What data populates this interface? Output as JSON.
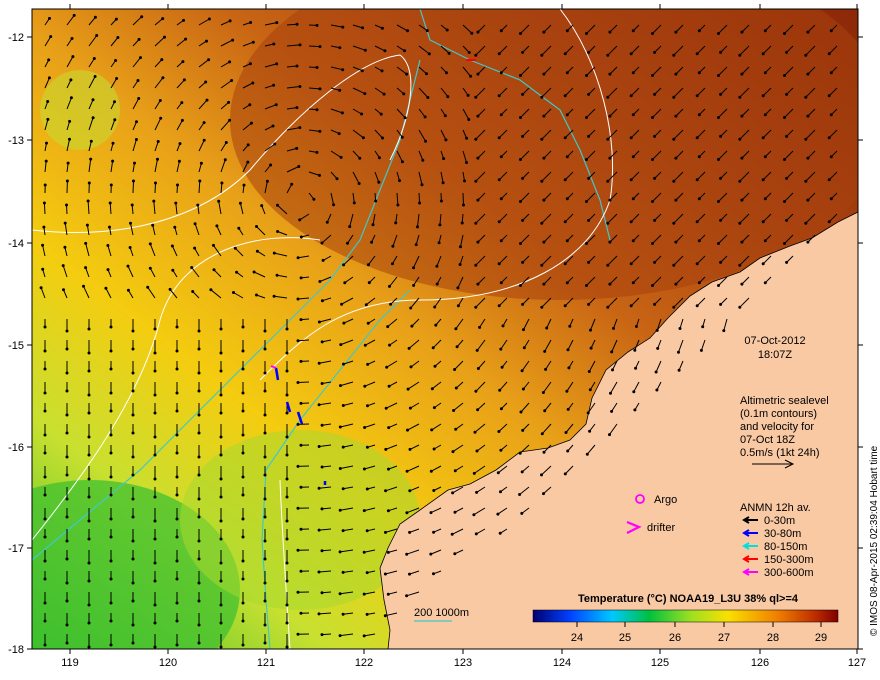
{
  "map": {
    "lon_ticks": [
      "119",
      "120",
      "121",
      "122",
      "123",
      "124",
      "125",
      "126",
      "127"
    ],
    "lat_ticks": [
      "-12",
      "-13",
      "-14",
      "-15",
      "-16",
      "-17",
      "-18"
    ]
  },
  "annotations": {
    "date": "07-Oct-2012",
    "time": "18:07Z",
    "altimetric_lines": [
      "Altimetric sealevel",
      "(0.1m contours)",
      "and velocity for",
      "07-Oct 18Z",
      "0.5m/s (1kt 24h)"
    ],
    "argo_label": "Argo",
    "drifter_label": "drifter",
    "anmn_title": "ANMN 12h av.",
    "anmn_legend": [
      {
        "label": "0-30m",
        "color": "#000000"
      },
      {
        "label": "30-80m",
        "color": "#0000ff"
      },
      {
        "label": "80-150m",
        "color": "#00e0e0"
      },
      {
        "label": "150-300m",
        "color": "#ff0000"
      },
      {
        "label": "300-600m",
        "color": "#ff00ff"
      }
    ],
    "isobath_label": "200  1000m",
    "credit": "© IMOS 08-Apr-2015 02:39:04 Hobart time"
  },
  "colorbar": {
    "title": "Temperature (°C) NOAA19_L3U 38% ql>=4",
    "ticks": [
      "24",
      "25",
      "26",
      "27",
      "28",
      "29"
    ]
  },
  "colors": {
    "land": "#f9c9a4",
    "isobath": "#40c8c8",
    "contour": "#ffffff",
    "argo": "#ff00ff",
    "drifter": "#ff00ff"
  }
}
